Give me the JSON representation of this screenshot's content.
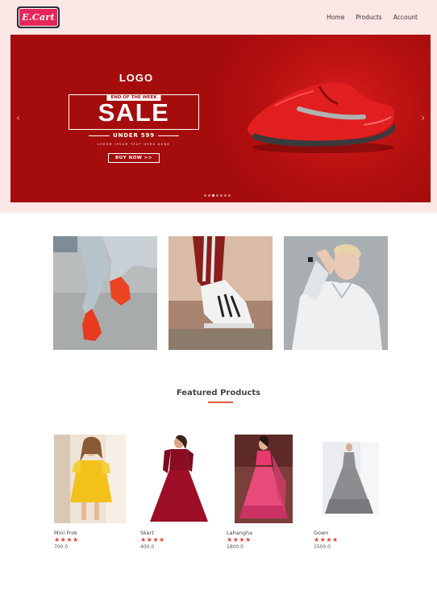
{
  "nav": {
    "logo_text": "E.Cart",
    "links": [
      "Home",
      "Products",
      "Account"
    ]
  },
  "banner": {
    "logo_text": "LOGO",
    "tag": "END OF THE WEEK",
    "headline": "SALE",
    "subline": "UNDER 599",
    "small_text": "LOREM IPSUM TEXT HERE DONE",
    "button": "BUY NOW  >>",
    "prev_arrow": "‹",
    "next_arrow": "›",
    "slide_count": 7,
    "active_slide": 3
  },
  "gallery": [
    {
      "name": "jeans-red-sneakers"
    },
    {
      "name": "striped-pants-sneaker"
    },
    {
      "name": "white-hoodie-woman"
    }
  ],
  "featured": {
    "title": "Featured Products",
    "products": [
      {
        "name": "Mini Frok",
        "rating": "★★★★",
        "price": "700.0"
      },
      {
        "name": "Skert",
        "rating": "★★★★",
        "price": "400.0"
      },
      {
        "name": "Lahangha",
        "rating": "★★★★",
        "price": "1800.0"
      },
      {
        "name": "Gown",
        "rating": "★★★★",
        "price": "1500.0"
      }
    ]
  },
  "colors": {
    "accent": "#e35b3c",
    "banner_bg": "#a50c0c",
    "header_bg": "#fde6e6",
    "star": "#e0423a"
  }
}
